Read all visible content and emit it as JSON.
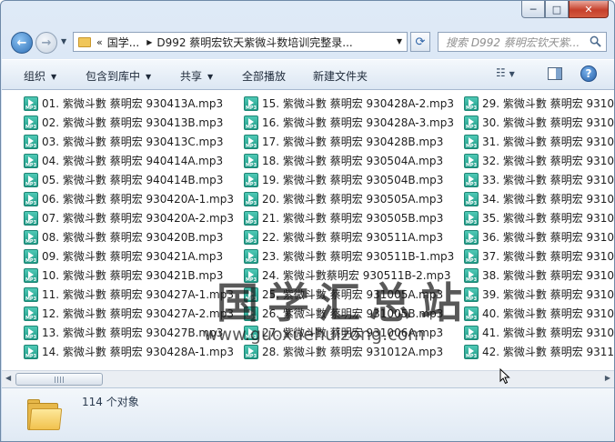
{
  "window": {
    "caption": {
      "minimize": "─",
      "maximize": "□",
      "close": "✕"
    }
  },
  "address": {
    "chevron": "«",
    "crumbs": [
      "国学...",
      "D992 蔡明宏钦天紫微斗数培训完整录..."
    ],
    "separator": "▶",
    "dropdown": "▼"
  },
  "search": {
    "placeholder": "搜索 D992 蔡明宏钦天紫..."
  },
  "toolbar": {
    "organize": "组织",
    "include_library": "包含到库中",
    "share": "共享",
    "play_all": "全部播放",
    "new_folder": "新建文件夹",
    "help": "?"
  },
  "files": {
    "col1": [
      "01. 紫微斗數 蔡明宏 930413A.mp3",
      "02. 紫微斗數 蔡明宏 930413B.mp3",
      "03. 紫微斗數 蔡明宏 930413C.mp3",
      "04. 紫微斗數 蔡明宏 940414A.mp3",
      "05. 紫微斗數 蔡明宏 940414B.mp3",
      "06. 紫微斗數 蔡明宏 930420A-1.mp3",
      "07. 紫微斗數 蔡明宏 930420A-2.mp3",
      "08. 紫微斗數 蔡明宏 930420B.mp3",
      "09. 紫微斗數 蔡明宏 930421A.mp3",
      "10. 紫微斗數 蔡明宏 930421B.mp3",
      "11. 紫微斗數 蔡明宏 930427A-1.mp3",
      "12. 紫微斗數 蔡明宏 930427A-2.mp3",
      "13. 紫微斗數 蔡明宏 930427B.mp3",
      "14. 紫微斗數 蔡明宏 930428A-1.mp3"
    ],
    "col2": [
      "15. 紫微斗數 蔡明宏 930428A-2.mp3",
      "16. 紫微斗數 蔡明宏 930428A-3.mp3",
      "17. 紫微斗數 蔡明宏 930428B.mp3",
      "18. 紫微斗數 蔡明宏 930504A.mp3",
      "19. 紫微斗數 蔡明宏 930504B.mp3",
      "20. 紫微斗數 蔡明宏 930505A.mp3",
      "21. 紫微斗數 蔡明宏 930505B.mp3",
      "22. 紫微斗數 蔡明宏 930511A.mp3",
      "23. 紫微斗數 蔡明宏 930511B-1.mp3",
      "24. 紫微斗數蔡明宏 930511B-2.mp3",
      "25. 紫微斗數 蔡明宏 931005A.mp3",
      "26. 紫微斗數 蔡明宏 931005B.mp3",
      "27. 紫微斗數 蔡明宏 931006A.mp3",
      "28. 紫微斗數 蔡明宏 931012A.mp3"
    ],
    "col3": [
      "29. 紫微斗數 蔡明宏 9310",
      "30. 紫微斗數 蔡明宏 9310",
      "31. 紫微斗數 蔡明宏 9310",
      "32. 紫微斗數 蔡明宏 9310",
      "33. 紫微斗數 蔡明宏 9310",
      "34. 紫微斗數 蔡明宏 9310",
      "35. 紫微斗數 蔡明宏 9310",
      "36. 紫微斗數 蔡明宏 9310",
      "37. 紫微斗數 蔡明宏 9310",
      "38. 紫微斗數 蔡明宏 9310",
      "39. 紫微斗數 蔡明宏 9310",
      "40. 紫微斗數 蔡明宏 9310",
      "41. 紫微斗數 蔡明宏 9310",
      "42. 紫微斗數 蔡明宏 9311"
    ]
  },
  "watermark": {
    "title": "国学汇总站",
    "url": "www.guoxuehuizong.com"
  },
  "scrollbar": {
    "left": "◀",
    "right": "▶"
  },
  "details": {
    "count": "114 个对象"
  },
  "icons": {
    "file": "mp3-file-icon",
    "folder": "folder-icon",
    "search": "search-icon",
    "refresh": "refresh-icon"
  },
  "colors": {
    "frame": "#cad9ec",
    "close_button": "#c6402b",
    "mp3_icon": "#1f9a86",
    "folder": "#f1c24e"
  }
}
